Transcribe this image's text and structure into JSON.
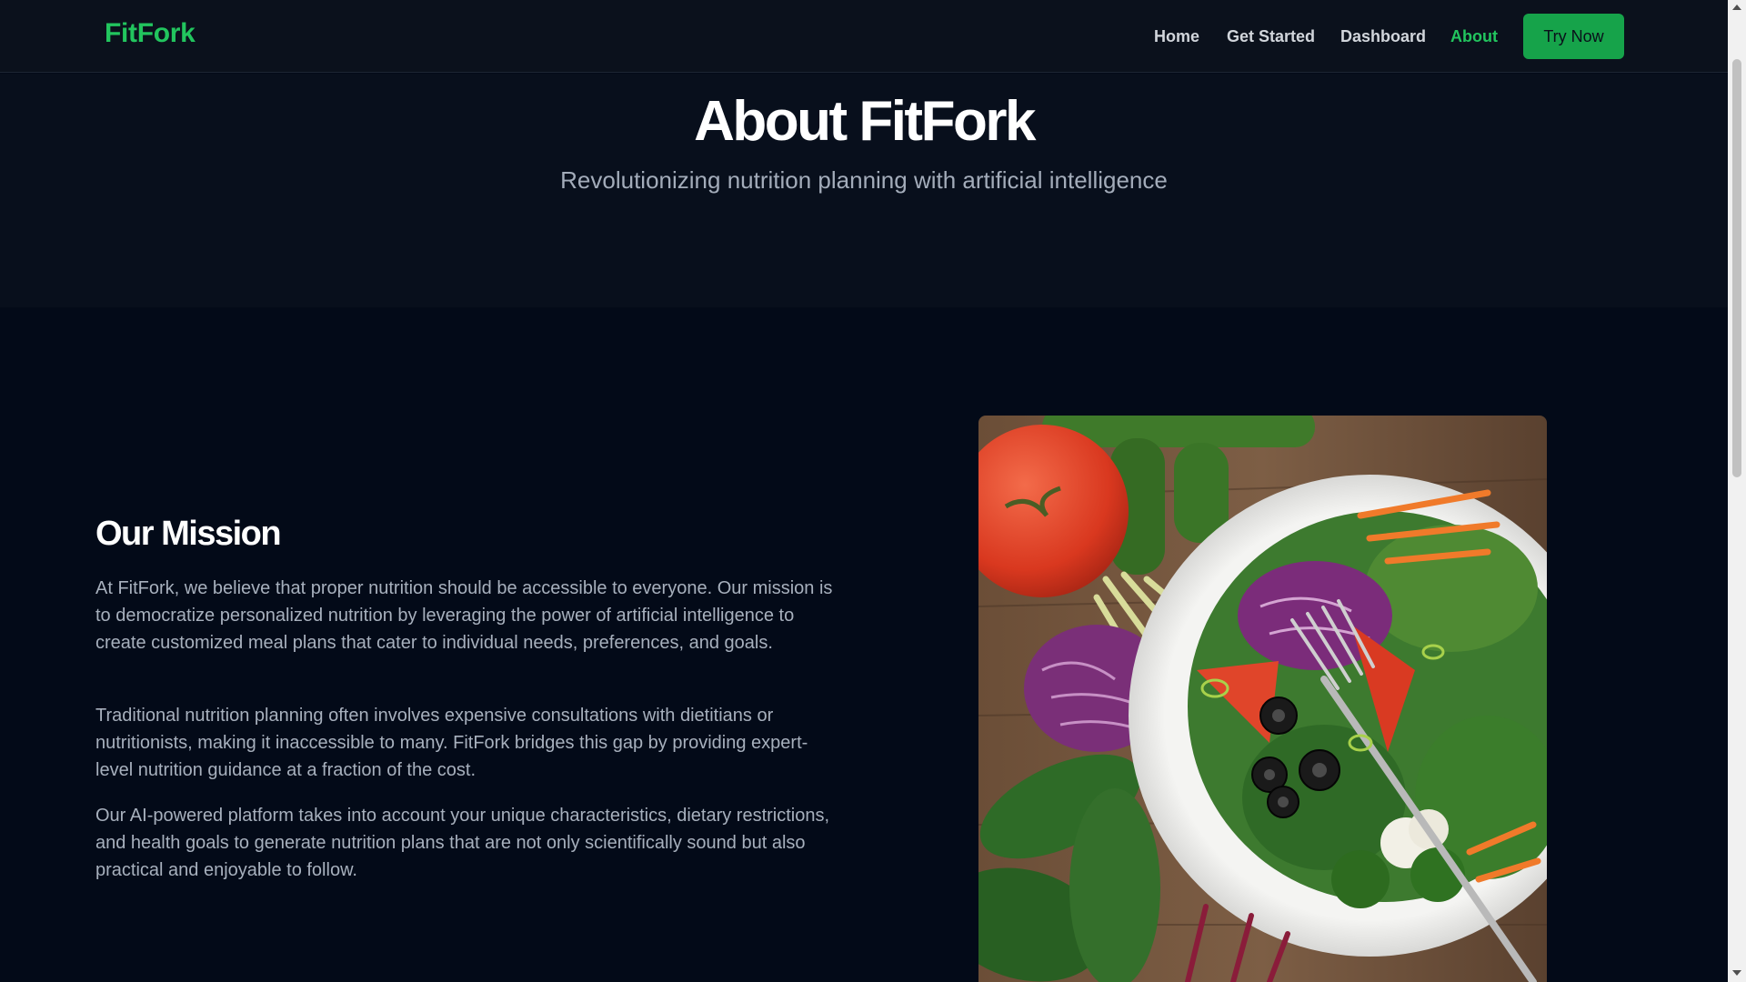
{
  "brand": {
    "name": "FitFork",
    "accent_color": "#22c55e"
  },
  "nav": {
    "links": [
      {
        "label": "Home",
        "active": false
      },
      {
        "label": "Get Started",
        "active": false
      },
      {
        "label": "Dashboard",
        "active": false
      },
      {
        "label": "About",
        "active": true
      }
    ],
    "cta_label": "Try Now"
  },
  "hero": {
    "title": "About FitFork",
    "subtitle": "Revolutionizing nutrition planning with artificial intelligence"
  },
  "mission": {
    "title": "Our Mission",
    "paragraphs": [
      "At FitFork, we believe that proper nutrition should be accessible to everyone. Our mission is to democratize personalized nutrition by leveraging the power of artificial intelligence to create customized meal plans that cater to individual needs, preferences, and goals.",
      "Traditional nutrition planning often involves expensive consultations with dietitians or nutritionists, making it inaccessible to many. FitFork bridges this gap by providing expert-level nutrition guidance at a fraction of the cost.",
      "Our AI-powered platform takes into account your unique characteristics, dietary restrictions, and health goals to generate nutrition plans that are not only scientifically sound but also practical and enjoyable to follow."
    ],
    "image_icon": "salad-photo"
  }
}
